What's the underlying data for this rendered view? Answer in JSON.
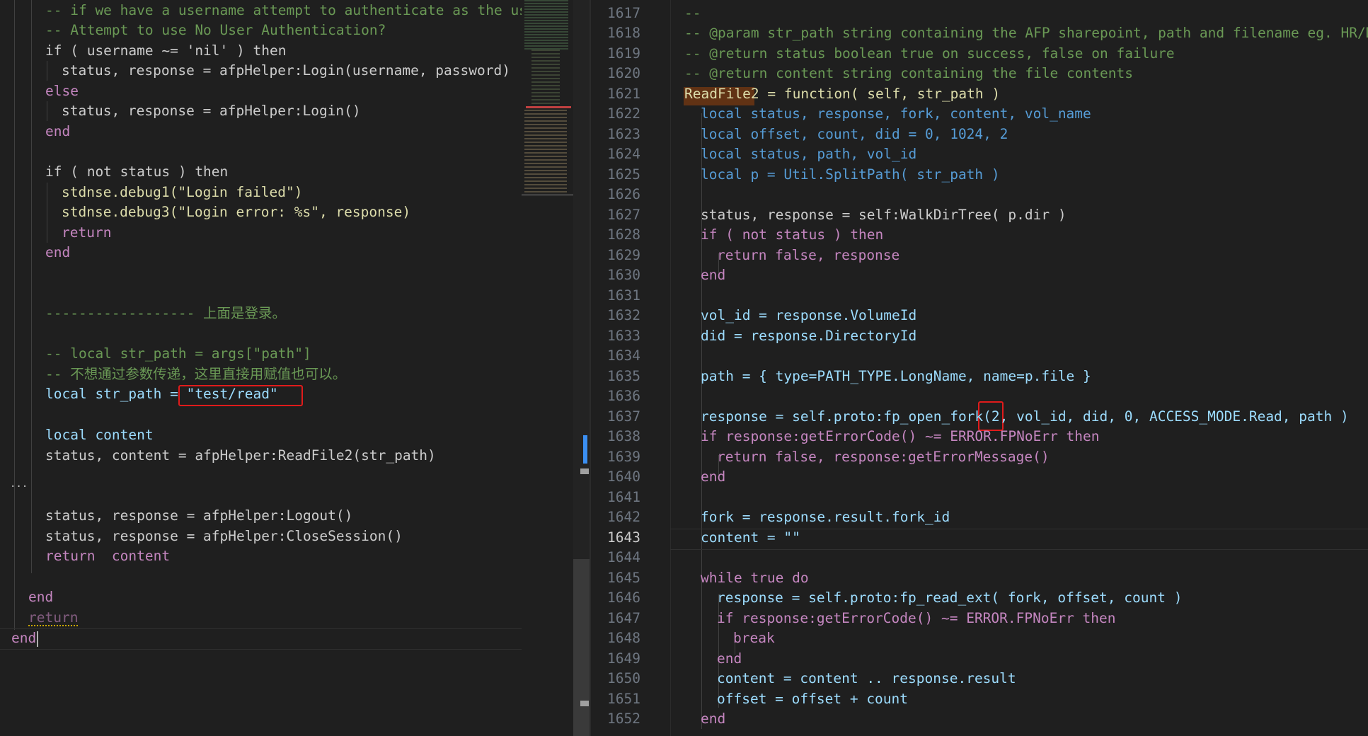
{
  "left_editor": {
    "lines": [
      "-- if we have a username attempt to authenticate as the user",
      "-- Attempt to use No User Authentication?",
      "if ( username ~= 'nil' ) then",
      "status, response = afpHelper:Login(username, password)",
      "else",
      "status, response = afpHelper:Login()",
      "end",
      "",
      "if ( not status ) then",
      "stdnse.debug1(\"Login failed\")",
      "stdnse.debug3(\"Login error: %s\", response)",
      "return",
      "end",
      "",
      "",
      "------------------ 上面是登录。",
      "",
      "-- local str_path = args[\"path\"]",
      "-- 不想通过参数传递，这里直接用赋值也可以。",
      "local str_path = \"test/read\"",
      "",
      "local content",
      "status, content = afpHelper:ReadFile2(str_path)",
      "...",
      "",
      "status, response = afpHelper:Logout()",
      "status, response = afpHelper:CloseSession()",
      "return  content",
      "",
      "end",
      "return",
      "end"
    ]
  },
  "right_editor": {
    "line_numbers": [
      "1617",
      "1618",
      "1619",
      "1620",
      "1621",
      "1622",
      "1623",
      "1624",
      "1625",
      "1626",
      "1627",
      "1628",
      "1629",
      "1630",
      "1631",
      "1632",
      "1633",
      "1634",
      "1635",
      "1636",
      "1637",
      "1638",
      "1639",
      "1640",
      "1641",
      "1642",
      "1643",
      "1644",
      "1645",
      "1646",
      "1647",
      "1648",
      "1649",
      "1650",
      "1651",
      "1652"
    ],
    "current_line": "1643",
    "lines": [
      "--",
      "-- @param str_path string containing the AFP sharepoint, path and filename eg. HR/Documents/",
      "-- @return status boolean true on success, false on failure",
      "-- @return content string containing the file contents",
      "ReadFile2 = function( self, str_path )",
      "local status, response, fork, content, vol_name",
      "local offset, count, did = 0, 1024, 2",
      "local status, path, vol_id",
      "local p = Util.SplitPath( str_path )",
      "",
      "status, response = self:WalkDirTree( p.dir )",
      "if ( not status ) then",
      "return false, response",
      "end",
      "",
      "vol_id = response.VolumeId",
      "did = response.DirectoryId",
      "",
      "path = { type=PATH_TYPE.LongName, name=p.file }",
      "",
      "response = self.proto:fp_open_fork(2, vol_id, did, 0, ACCESS_MODE.Read, path )",
      "if response:getErrorCode() ~= ERROR.FPNoErr then",
      "return false, response:getErrorMessage()",
      "end",
      "",
      "fork = response.result.fork_id",
      "content = \"\"",
      "",
      "while true do",
      "response = self.proto:fp_read_ext( fork, offset, count )",
      "if response:getErrorCode() ~= ERROR.FPNoErr then",
      "break",
      "end",
      "content = content .. response.result",
      "offset = offset + count",
      "end"
    ]
  }
}
